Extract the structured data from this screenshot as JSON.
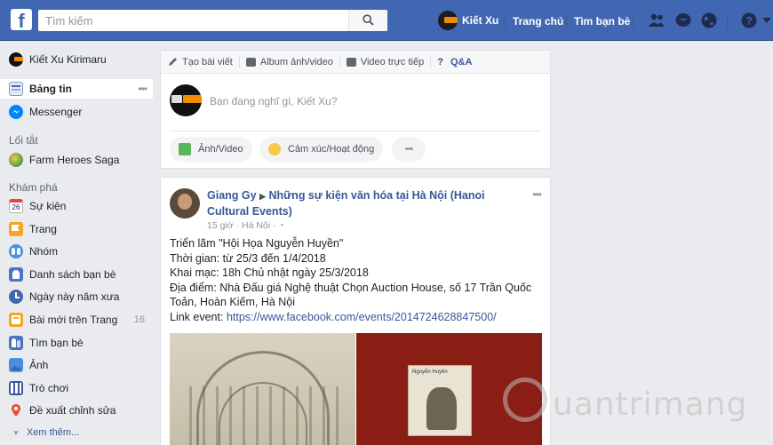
{
  "topbar": {
    "logo": "f",
    "search_placeholder": "Tìm kiếm",
    "profile_name": "Kiết Xu",
    "home_label": "Trang chủ",
    "find_friends_label": "Tìm bạn bè",
    "icons": [
      "friends-icon",
      "messenger-icon",
      "globe-icon",
      "help-icon"
    ],
    "brand_color": "#4267b2"
  },
  "sidebar": {
    "profile": "Kiết Xu Kirimaru",
    "main": [
      {
        "label": "Bảng tin",
        "icon": "news-feed-icon",
        "active": true,
        "more": "•••"
      },
      {
        "label": "Messenger",
        "icon": "messenger-icon"
      }
    ],
    "shortcuts_title": "Lối tắt",
    "shortcuts": [
      {
        "label": "Farm Heroes Saga",
        "icon": "game-icon"
      }
    ],
    "explore_title": "Khám phá",
    "explore": [
      {
        "label": "Sự kiện",
        "icon": "calendar-icon",
        "badge": "26"
      },
      {
        "label": "Trang",
        "icon": "flag-icon"
      },
      {
        "label": "Nhóm",
        "icon": "groups-icon"
      },
      {
        "label": "Danh sách bạn bè",
        "icon": "friend-list-icon"
      },
      {
        "label": "Ngày này năm xưa",
        "icon": "memories-icon"
      },
      {
        "label": "Bài mới trên Trang",
        "icon": "page-feed-icon",
        "count": "16"
      },
      {
        "label": "Tìm bạn bè",
        "icon": "find-friends-icon"
      },
      {
        "label": "Ảnh",
        "icon": "photos-icon"
      },
      {
        "label": "Trò chơi",
        "icon": "games-icon"
      },
      {
        "label": "Đề xuất chỉnh sửa",
        "icon": "map-pin-icon"
      }
    ],
    "see_more": "Xem thêm..."
  },
  "composer": {
    "tabs": [
      {
        "label": "Tạo bài viết",
        "icon": "pencil-icon"
      },
      {
        "label": "Album ảnh/video",
        "icon": "album-icon"
      },
      {
        "label": "Video trực tiếp",
        "icon": "live-video-icon"
      },
      {
        "label": "Q&A",
        "icon": "question-icon"
      }
    ],
    "placeholder": "Bạn đang nghĩ gì, Kiết Xu?",
    "actions": [
      {
        "label": "Ảnh/Video",
        "icon": "photo-icon"
      },
      {
        "label": "Cảm xúc/Hoạt động",
        "icon": "emoji-icon"
      },
      {
        "label": "•••",
        "icon": "more-icon"
      }
    ]
  },
  "post": {
    "author": "Giang Gy",
    "arrow": "▶",
    "target": "Những sự kiện văn hóa tại Hà Nội (Hanoi Cultural Events)",
    "time": "15 giờ · Hà Nội · ◔",
    "lines": [
      "Triển lãm \"Hội Họa Nguyễn Huyền\"",
      "Thời gian: từ 25/3 đến 1/4/2018",
      "Khai mạc: 18h Chủ nhật ngày 25/3/2018",
      "Địa điểm: Nhà Đấu giá Nghệ thuật Chọn Auction House, số 17 Trần Quốc Toản, Hoàn Kiếm, Hà Nội"
    ],
    "link_prefix": "Link event: ",
    "link": "https://www.facebook.com/events/2014724628847500/",
    "book_title": "Nguyễn Huyền"
  },
  "watermark": "uantrimang"
}
